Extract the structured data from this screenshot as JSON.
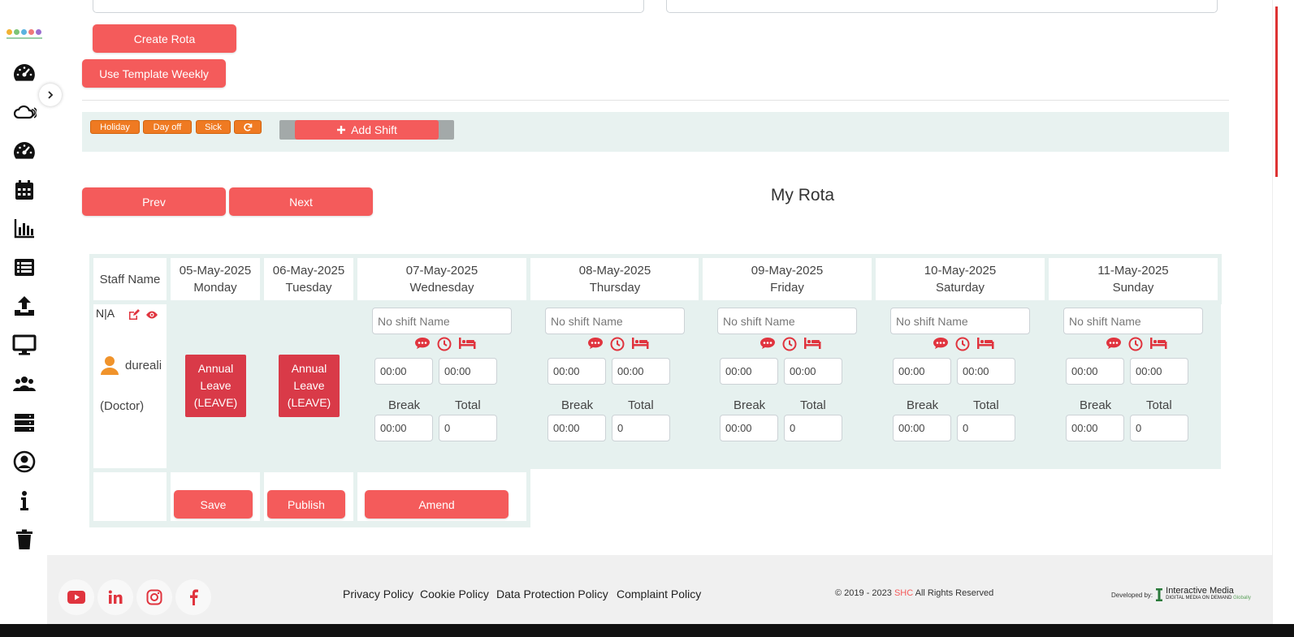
{
  "actions": {
    "create_rota": "Create Rota",
    "use_template": "Use Template Weekly"
  },
  "toolbar": {
    "tags": [
      "Holiday",
      "Day off",
      "Sick"
    ],
    "add_shift": "Add Shift"
  },
  "nav": {
    "prev": "Prev",
    "next": "Next"
  },
  "title": "My Rota",
  "table": {
    "staff_header": "Staff Name",
    "days": [
      {
        "date": "05-May-2025",
        "day": "Monday"
      },
      {
        "date": "06-May-2025",
        "day": "Tuesday"
      },
      {
        "date": "07-May-2025",
        "day": "Wednesday"
      },
      {
        "date": "08-May-2025",
        "day": "Thursday"
      },
      {
        "date": "09-May-2025",
        "day": "Friday"
      },
      {
        "date": "10-May-2025",
        "day": "Saturday"
      },
      {
        "date": "11-May-2025",
        "day": "Sunday"
      }
    ],
    "staff": {
      "code": "N|A",
      "name": "dureali",
      "role": "(Doctor)"
    },
    "leave_label": "Annual Leave (LEAVE)",
    "shift_placeholder": "No shift Name",
    "start_time": "00:00",
    "end_time": "00:00",
    "break_label": "Break",
    "total_label": "Total",
    "break_value": "00:00",
    "total_value": "0",
    "save": "Save",
    "publish": "Publish",
    "amend": "Amend"
  },
  "footer": {
    "links": [
      "Privacy Policy",
      "Cookie Policy",
      "Data Protection Policy",
      "Complaint Policy"
    ],
    "copyright_prefix": "© 2019 - 2023 ",
    "copyright_brand": "SHC",
    "copyright_suffix": " All Rights Reserved",
    "developed_by": "Developed by:",
    "dev_name": "Interactive Media",
    "dev_tagline": "DIGITAL MEDIA ON DEMAND",
    "dev_tagline2": "Globally"
  },
  "colors": {
    "primary": "#f45b5b",
    "tag_orange": "#ef7a22",
    "leave_red": "#d93a48",
    "panel_green": "#e6f1ef"
  },
  "sidebar_icons": [
    "dashboard-icon",
    "cloud-icon",
    "dashboard-icon-2",
    "calendar-icon",
    "bar-chart-icon",
    "list-icon",
    "upload-icon",
    "monitor-icon",
    "users-icon",
    "server-icon",
    "user-circle-icon",
    "info-icon",
    "trash-icon"
  ]
}
